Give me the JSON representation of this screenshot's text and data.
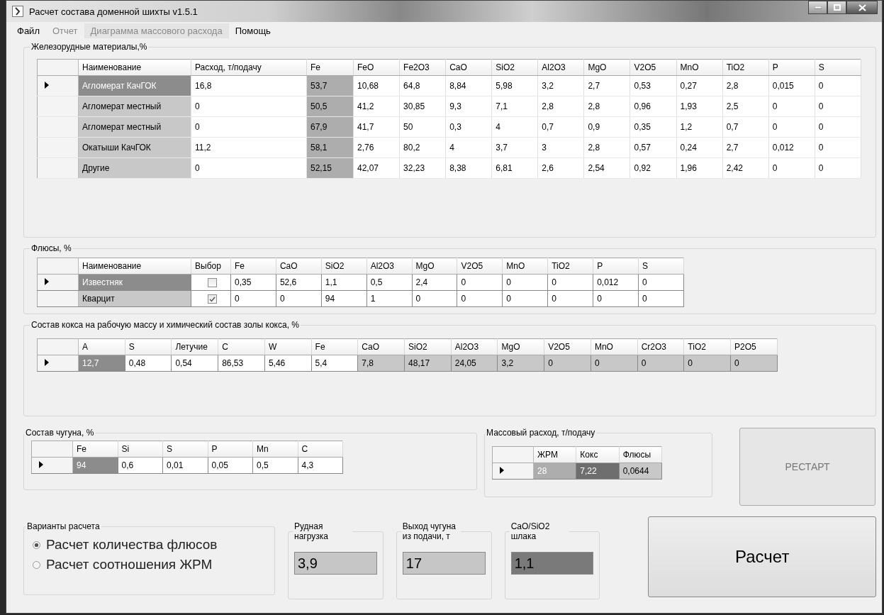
{
  "window": {
    "title": "Расчет состава доменной шихты v1.5.1"
  },
  "menu": [
    {
      "label": "Файл",
      "disabled": false
    },
    {
      "label": "Отчет",
      "disabled": true
    },
    {
      "label": "Диаграмма массового расхода",
      "disabled": true
    },
    {
      "label": "Помощь",
      "disabled": false
    }
  ],
  "iron_materials": {
    "title": "Железорудные материалы,%",
    "columns": [
      {
        "label": "Наименование",
        "color": "#c8c8c8",
        "kind": "text"
      },
      {
        "label": "Расход, т/подачу",
        "kind": "text"
      },
      {
        "label": "Fe",
        "color": "#adadad",
        "kind": "text"
      },
      {
        "label": "FeO",
        "kind": "text"
      },
      {
        "label": "Fe2O3",
        "kind": "text"
      },
      {
        "label": "CaO",
        "kind": "text"
      },
      {
        "label": "SiO2",
        "kind": "text"
      },
      {
        "label": "Al2O3",
        "kind": "text"
      },
      {
        "label": "MgO",
        "kind": "text"
      },
      {
        "label": "V2O5",
        "kind": "text"
      },
      {
        "label": "MnO",
        "kind": "text"
      },
      {
        "label": "TiO2",
        "kind": "text"
      },
      {
        "label": "P",
        "kind": "text"
      },
      {
        "label": "S",
        "kind": "text"
      }
    ],
    "rows": [
      {
        "selected": true,
        "cells": [
          "Агломерат КачГОК",
          "16,8",
          "53,7",
          "10,68",
          "64,8",
          "8,84",
          "5,98",
          "3,2",
          "2,7",
          "0,53",
          "0,27",
          "2,8",
          "0,015",
          "0"
        ]
      },
      {
        "selected": false,
        "cells": [
          "Агломерат местный",
          "0",
          "50,5",
          "41,2",
          "30,85",
          "9,3",
          "7,1",
          "2,8",
          "2,8",
          "0,96",
          "1,93",
          "2,5",
          "0",
          "0"
        ]
      },
      {
        "selected": false,
        "cells": [
          "Агломерат местный",
          "0",
          "67,9",
          "41,7",
          "50",
          "0,3",
          "4",
          "0,7",
          "0,9",
          "0,35",
          "1,2",
          "0,7",
          "0",
          "0"
        ]
      },
      {
        "selected": false,
        "cells": [
          "Окатыши КачГОК",
          "11,2",
          "58,1",
          "2,76",
          "80,2",
          "4",
          "3,7",
          "3",
          "2,8",
          "0,57",
          "0,24",
          "2,7",
          "0,012",
          "0"
        ]
      },
      {
        "selected": false,
        "cells": [
          "Другие",
          "0",
          "52,15",
          "42,07",
          "32,23",
          "8,38",
          "6,81",
          "2,6",
          "2,54",
          "0,92",
          "1,96",
          "2,42",
          "0",
          "0"
        ]
      }
    ]
  },
  "fluxes": {
    "title": "Флюсы, %",
    "columns": [
      {
        "label": "Наименование",
        "color": "#c8c8c8",
        "kind": "text"
      },
      {
        "label": "Выбор",
        "kind": "check"
      },
      {
        "label": "Fe",
        "kind": "text"
      },
      {
        "label": "CaO",
        "kind": "text"
      },
      {
        "label": "SiO2",
        "kind": "text"
      },
      {
        "label": "Al2O3",
        "kind": "text"
      },
      {
        "label": "MgO",
        "kind": "text"
      },
      {
        "label": "V2O5",
        "kind": "text"
      },
      {
        "label": "MnO",
        "kind": "text"
      },
      {
        "label": "TiO2",
        "kind": "text"
      },
      {
        "label": "P",
        "kind": "text"
      },
      {
        "label": "S",
        "kind": "text"
      }
    ],
    "rows": [
      {
        "selected": true,
        "cells": [
          "Известняк",
          false,
          "0,35",
          "52,6",
          "1,1",
          "0,5",
          "2,4",
          "0",
          "0",
          "0",
          "0,012",
          "0"
        ]
      },
      {
        "selected": false,
        "cells": [
          "Кварцит",
          true,
          "0",
          "0",
          "94",
          "1",
          "0",
          "0",
          "0",
          "0",
          "0",
          "0"
        ]
      }
    ]
  },
  "coke": {
    "title": "Состав кокса на рабочую массу и химический состав золы кокса, %",
    "columns": [
      {
        "label": "A",
        "kind": "text"
      },
      {
        "label": "S",
        "kind": "text"
      },
      {
        "label": "Летучие",
        "kind": "text"
      },
      {
        "label": "C",
        "kind": "text"
      },
      {
        "label": "W",
        "kind": "text"
      },
      {
        "label": "Fe",
        "kind": "text"
      },
      {
        "label": "CaO",
        "color": "#c8c8c8",
        "kind": "text"
      },
      {
        "label": "SiO2",
        "color": "#c8c8c8",
        "kind": "text"
      },
      {
        "label": "Al2O3",
        "color": "#c8c8c8",
        "kind": "text"
      },
      {
        "label": "MgO",
        "color": "#c8c8c8",
        "kind": "text"
      },
      {
        "label": "V2O5",
        "color": "#c8c8c8",
        "kind": "text"
      },
      {
        "label": "MnO",
        "color": "#c8c8c8",
        "kind": "text"
      },
      {
        "label": "Cr2O3",
        "color": "#c8c8c8",
        "kind": "text"
      },
      {
        "label": "TiO2",
        "color": "#c8c8c8",
        "kind": "text"
      },
      {
        "label": "P2O5",
        "color": "#c8c8c8",
        "kind": "text"
      }
    ],
    "rows": [
      {
        "selected": true,
        "cells": [
          "12,7",
          "0,48",
          "0,54",
          "86,53",
          "5,46",
          "5,4",
          "7,8",
          "48,17",
          "24,05",
          "3,2",
          "0",
          "0",
          "0",
          "0",
          "0"
        ]
      }
    ]
  },
  "cast_iron": {
    "title": "Состав чугуна, %",
    "columns": [
      {
        "label": "Fe"
      },
      {
        "label": "Si"
      },
      {
        "label": "S"
      },
      {
        "label": "P"
      },
      {
        "label": "Mn"
      },
      {
        "label": "C"
      }
    ],
    "rows": [
      {
        "selected": true,
        "cells": [
          "94",
          "0,6",
          "0,01",
          "0,05",
          "0,5",
          "4,3"
        ]
      }
    ]
  },
  "mass_flow": {
    "title": "Массовый расход, т/подачу",
    "columns": [
      {
        "label": "ЖРМ",
        "color": "#adadad"
      },
      {
        "label": "Кокс",
        "color": "#6e6e6e"
      },
      {
        "label": "Флюсы",
        "color": "#c8c8c8"
      }
    ],
    "rows": [
      {
        "selected": true,
        "cells": [
          "28",
          "7,22",
          "0,0644"
        ]
      }
    ]
  },
  "restart_button": {
    "label": "РЕСТАРТ",
    "disabled": true
  },
  "calc_options": {
    "title": "Варианты расчета",
    "options": [
      {
        "label": "Расчет количества флюсов",
        "selected": true
      },
      {
        "label": "Расчет соотношения ЖРМ",
        "selected": false
      }
    ]
  },
  "outputs": [
    {
      "label": "Рудная нагрузка",
      "value": "3,9",
      "color": "#c6c6c6"
    },
    {
      "label": "Выход чугуна из подачи, т",
      "value": "17",
      "color": "#c6c6c6"
    },
    {
      "label": "CaO/SiO2 шлака",
      "value": "1,1",
      "color": "#7a7a7a"
    }
  ],
  "calc_button": {
    "label": "Расчет"
  }
}
